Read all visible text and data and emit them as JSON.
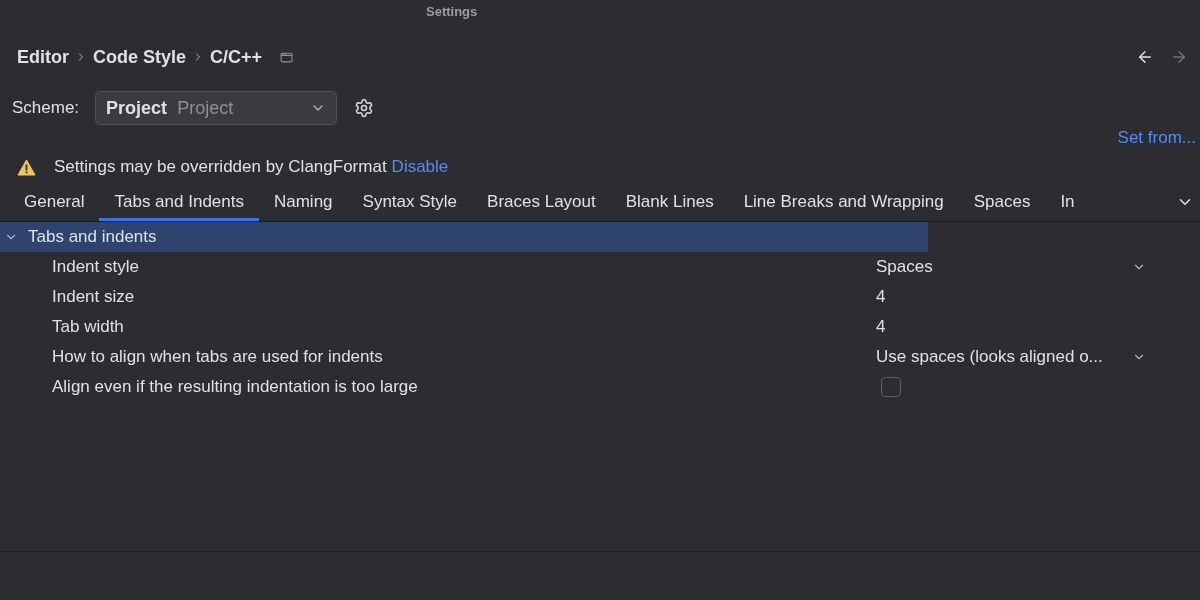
{
  "window": {
    "title": "Settings"
  },
  "breadcrumbs": [
    "Editor",
    "Code Style",
    "C/C++"
  ],
  "scheme": {
    "label": "Scheme:",
    "name": "Project",
    "source": "Project"
  },
  "set_from": "Set from...",
  "warning": {
    "text": "Settings may be overridden by ClangFormat",
    "link": "Disable"
  },
  "tabs": [
    {
      "label": "General",
      "selected": false
    },
    {
      "label": "Tabs and Indents",
      "selected": true
    },
    {
      "label": "Naming",
      "selected": false
    },
    {
      "label": "Syntax Style",
      "selected": false
    },
    {
      "label": "Braces Layout",
      "selected": false
    },
    {
      "label": "Blank Lines",
      "selected": false
    },
    {
      "label": "Line Breaks and Wrapping",
      "selected": false
    },
    {
      "label": "Spaces",
      "selected": false
    },
    {
      "label": "In",
      "selected": false
    }
  ],
  "group": {
    "label": "Tabs and indents",
    "expanded": true,
    "selected": true,
    "options": [
      {
        "label": "Indent style",
        "kind": "dropdown",
        "value": "Spaces"
      },
      {
        "label": "Indent size",
        "kind": "text",
        "value": "4"
      },
      {
        "label": "Tab width",
        "kind": "text",
        "value": "4"
      },
      {
        "label": "How to align when tabs are used for indents",
        "kind": "dropdown",
        "value": "Use spaces (looks aligned o..."
      },
      {
        "label": "Align even if the resulting indentation is too large",
        "kind": "checkbox",
        "checked": false
      }
    ]
  }
}
